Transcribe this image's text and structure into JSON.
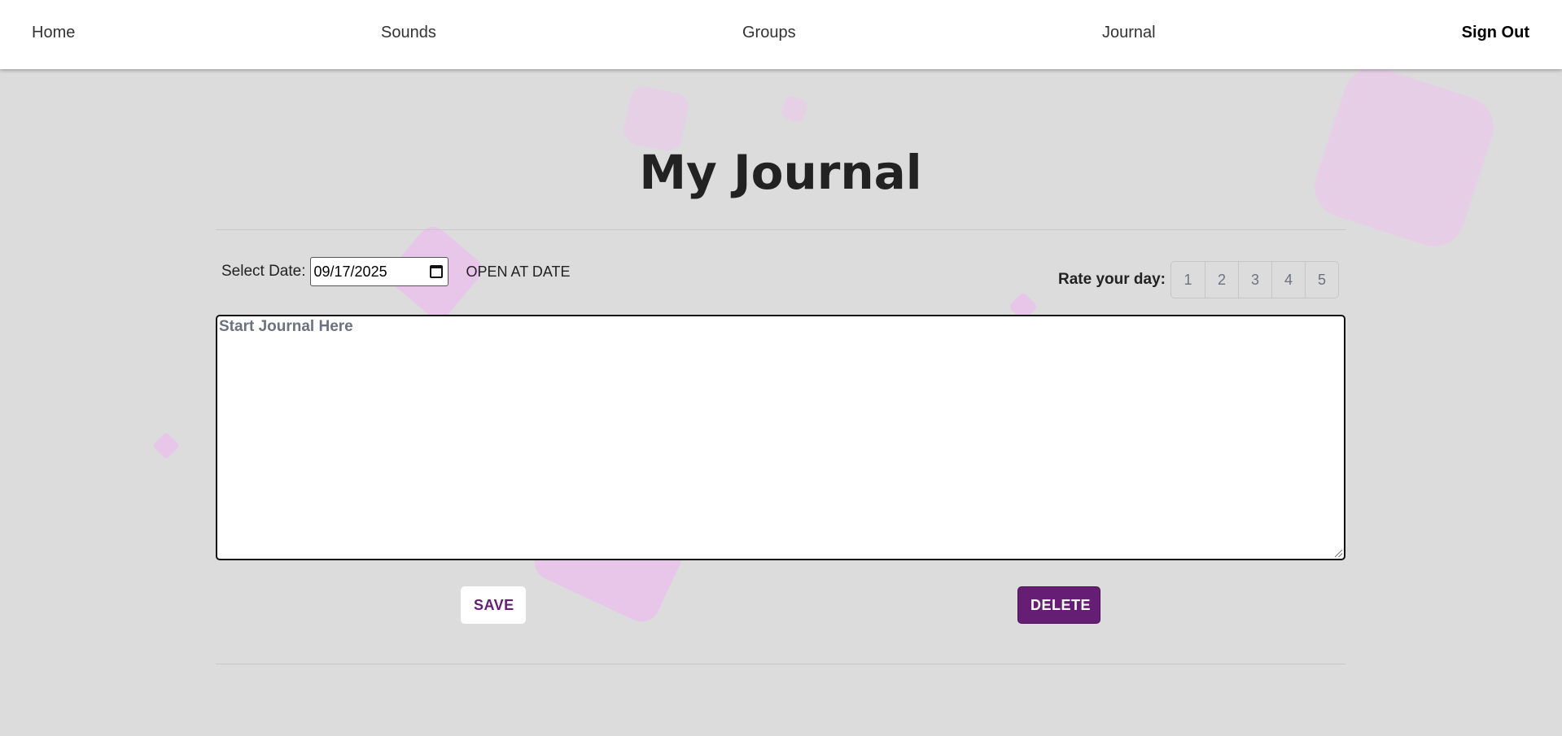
{
  "nav": {
    "home": "Home",
    "sounds": "Sounds",
    "groups": "Groups",
    "journal": "Journal",
    "sign_out": "Sign Out"
  },
  "page": {
    "title": "My Journal"
  },
  "date_picker": {
    "label": "Select Date:",
    "value": "09/17/2025",
    "open_button": "OPEN AT DATE"
  },
  "rating": {
    "label": "Rate your day:",
    "options": [
      "1",
      "2",
      "3",
      "4",
      "5"
    ]
  },
  "editor": {
    "placeholder": "Start Journal Here"
  },
  "actions": {
    "save": "SAVE",
    "delete": "DELETE"
  },
  "colors": {
    "background": "#dcdcdc",
    "navbar": "#ffffff",
    "accent_purple": "#651e73",
    "decor_pink": "#e8c6ea"
  }
}
